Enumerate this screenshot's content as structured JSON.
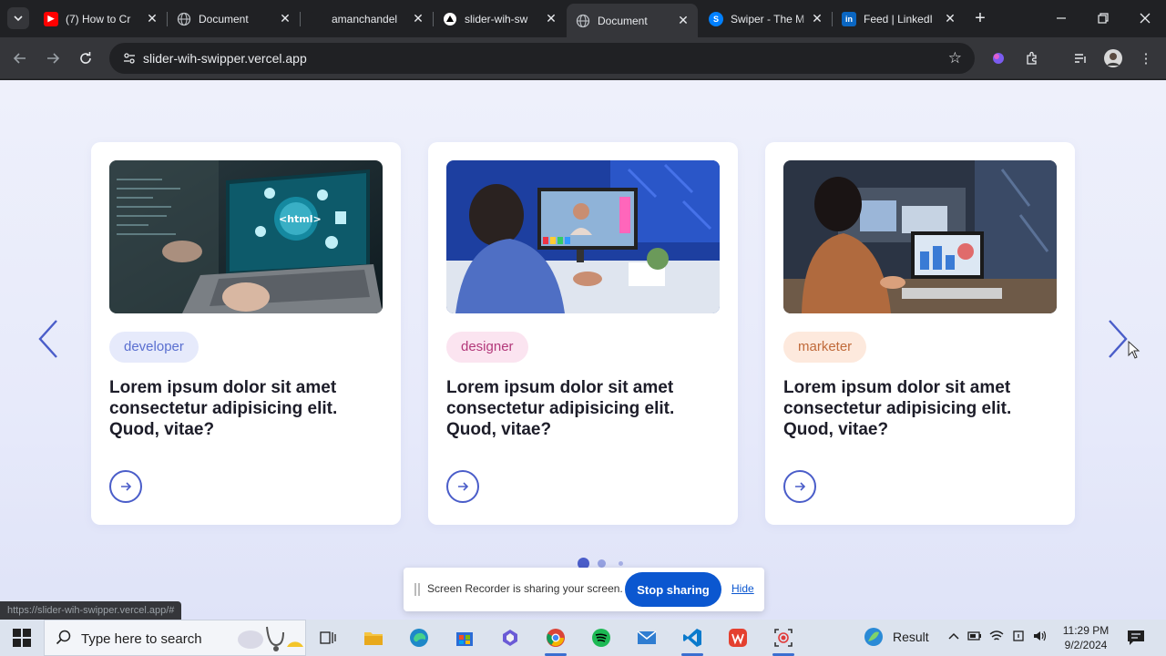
{
  "browser": {
    "tabs": [
      {
        "title": "(7) How to Cr",
        "favicon": "youtube-icon",
        "active": false
      },
      {
        "title": "Document",
        "favicon": "globe-icon",
        "active": false
      },
      {
        "title": "amanchandel",
        "favicon": "github-icon",
        "active": false
      },
      {
        "title": "slider-wih-sw",
        "favicon": "vercel-icon",
        "active": false
      },
      {
        "title": "Document",
        "favicon": "globe-icon",
        "active": true
      },
      {
        "title": "Swiper - The M",
        "favicon": "swiper-icon",
        "active": false
      },
      {
        "title": "Feed | LinkedI",
        "favicon": "linkedin-icon",
        "active": false
      }
    ],
    "url": "slider-wih-swipper.vercel.app",
    "status_url": "https://slider-wih-swipper.vercel.app/#"
  },
  "slider": {
    "cards": [
      {
        "tag": "developer",
        "text": "Lorem ipsum dolor sit amet consectetur adipisicing elit. Quod, vitae?",
        "tag_color": "#5a6fd0",
        "tag_bg": "#e6eafb",
        "image": "laptop-html-photo"
      },
      {
        "tag": "designer",
        "text": "Lorem ipsum dolor sit amet consectetur adipisicing elit. Quod, vitae?",
        "tag_color": "#b3387a",
        "tag_bg": "#fbe4f0",
        "image": "designer-desk-photo"
      },
      {
        "tag": "marketer",
        "text": "Lorem ipsum dolor sit amet consectetur adipisicing elit. Quod, vitae?",
        "tag_color": "#c06a3a",
        "tag_bg": "#fde9dd",
        "image": "marketer-office-photo"
      }
    ],
    "pagination": {
      "count": 3,
      "active": 1
    },
    "accent": "#4a5dc9"
  },
  "share_bar": {
    "message": "Screen Recorder is sharing your screen.",
    "stop_label": "Stop sharing",
    "hide_label": "Hide"
  },
  "taskbar": {
    "search_placeholder": "Type here to search",
    "result_label": "Result",
    "time": "11:29 PM",
    "date": "9/2/2024"
  }
}
